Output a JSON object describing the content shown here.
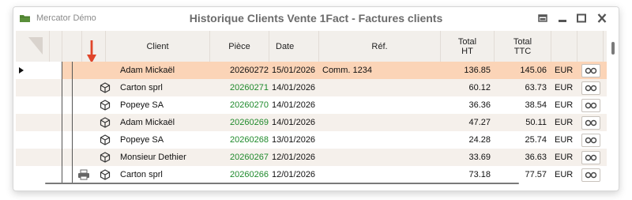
{
  "app_name": "Mercator Démo",
  "window_title": "Historique Clients Vente 1Fact - Factures clients",
  "colors": {
    "selected_row": "#fbd4b7",
    "zebra": "#f5f0eb",
    "piece_green": "#1f8a2c",
    "arrow_red": "#e0452a"
  },
  "columns": {
    "client": "Client",
    "piece": "Pièce",
    "date": "Date",
    "ref": "Réf.",
    "total_ht_1": "Total",
    "total_ht_2": "HT",
    "total_ttc_1": "Total",
    "total_ttc_2": "TTC"
  },
  "rows": [
    {
      "client": "Adam Mickaël",
      "piece": "20260272",
      "date": "15/01/2026",
      "ref": "Comm. 1234",
      "ht": "136.85",
      "ttc": "145.06",
      "currency": "EUR",
      "selected": true,
      "icon": "row-pointer-icon",
      "green": false
    },
    {
      "client": "Carton sprl",
      "piece": "20260271",
      "date": "14/01/2026",
      "ref": "",
      "ht": "60.12",
      "ttc": "63.73",
      "currency": "EUR",
      "icon": "cube-icon",
      "green": true
    },
    {
      "client": "Popeye SA",
      "piece": "20260270",
      "date": "14/01/2026",
      "ref": "",
      "ht": "36.36",
      "ttc": "38.54",
      "currency": "EUR",
      "icon": "cube-icon",
      "green": true
    },
    {
      "client": "Adam Mickaël",
      "piece": "20260269",
      "date": "14/01/2026",
      "ref": "",
      "ht": "47.27",
      "ttc": "50.11",
      "currency": "EUR",
      "icon": "cube-icon",
      "green": true
    },
    {
      "client": "Popeye SA",
      "piece": "20260268",
      "date": "13/01/2026",
      "ref": "",
      "ht": "24.28",
      "ttc": "25.74",
      "currency": "EUR",
      "icon": "cube-icon",
      "green": true
    },
    {
      "client": "Monsieur Dethier",
      "piece": "20260267",
      "date": "12/01/2026",
      "ref": "",
      "ht": "33.69",
      "ttc": "36.63",
      "currency": "EUR",
      "icon": "cube-icon",
      "green": true
    },
    {
      "client": "Carton sprl",
      "piece": "20260266",
      "date": "12/01/2026",
      "ref": "",
      "ht": "73.18",
      "ttc": "77.57",
      "currency": "EUR",
      "icon": "cube-icon",
      "print": true,
      "green": true
    }
  ]
}
